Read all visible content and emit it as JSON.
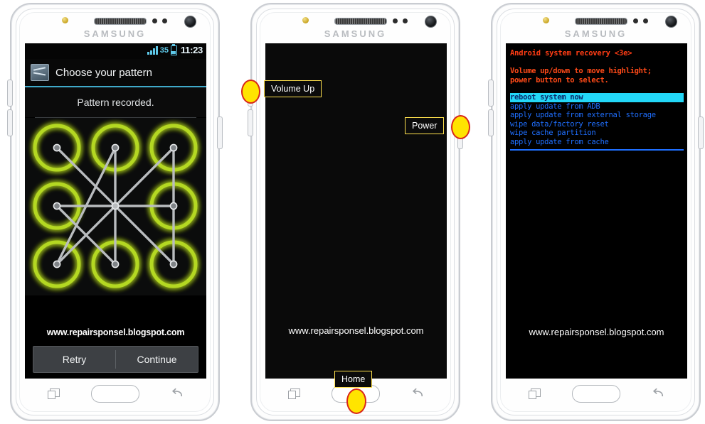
{
  "brand": "SAMSUNG",
  "watermark": "www.repairsponsel.blogspot.com",
  "phone1": {
    "status_bar": {
      "battery_percent": "35",
      "time": "11:23",
      "signal_icon": "signal-bars-icon",
      "battery_icon": "battery-icon"
    },
    "app_header": {
      "icon": "pattern-settings-icon",
      "title": "Choose your pattern"
    },
    "message": "Pattern recorded.",
    "buttons": {
      "retry": "Retry",
      "continue": "Continue"
    },
    "pattern": {
      "dot_count": 9,
      "lit_dots": [
        1,
        2,
        3,
        4,
        6,
        7,
        8,
        9
      ],
      "unlit_dots": [
        5
      ],
      "ring_color": "#b4d820",
      "line_color": "#b9bcbf",
      "path": [
        1,
        9,
        3,
        7,
        2,
        8,
        4,
        6
      ]
    }
  },
  "phone2": {
    "screen_state": "black",
    "callouts": [
      {
        "label": "Volume Up",
        "marker": "volume-up-marker"
      },
      {
        "label": "Power",
        "marker": "power-marker"
      },
      {
        "label": "Home",
        "marker": "home-marker"
      }
    ]
  },
  "phone3": {
    "recovery": {
      "title": "Android system recovery <3e>",
      "instructions": [
        "Volume up/down to move highlight;",
        "power button to select."
      ],
      "menu": [
        {
          "label": "reboot system now",
          "selected": true
        },
        {
          "label": "apply update from ADB",
          "selected": false
        },
        {
          "label": "apply update from external storage",
          "selected": false
        },
        {
          "label": "wipe data/factory reset",
          "selected": false
        },
        {
          "label": "wipe cache partition",
          "selected": false
        },
        {
          "label": "apply update from cache",
          "selected": false
        }
      ],
      "colors": {
        "title": "#ff3c14",
        "instructions": "#ff4a18",
        "menu_item": "#1f6fff",
        "selected_bg": "#23d7f7",
        "selected_text": "#0a2a6b"
      }
    }
  },
  "nav": {
    "recents_icon": "recents-icon",
    "home_button": "home-button",
    "back_icon": "back-icon"
  }
}
